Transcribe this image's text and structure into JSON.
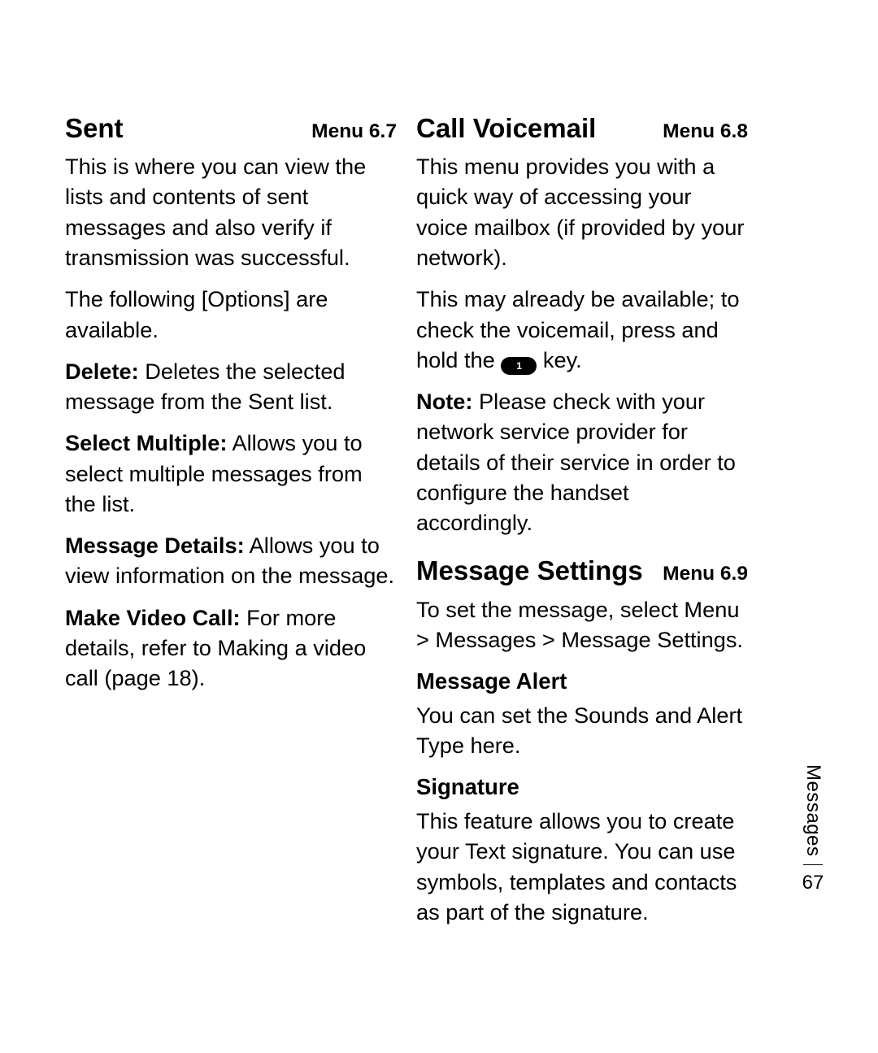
{
  "left": {
    "heading": "Sent",
    "menu": "Menu 6.7",
    "intro": "This is where you can view the lists and contents of sent messages and also verify if transmission was successful.",
    "options_intro": "The following [Options] are available.",
    "items": [
      {
        "term": "Delete:",
        "desc": " Deletes the selected message from the Sent list."
      },
      {
        "term": "Select Multiple:",
        "desc": " Allows you to select multiple messages from the list."
      },
      {
        "term": "Message Details:",
        "desc": " Allows you to view information on the message."
      },
      {
        "term": "Make Video Call:",
        "desc": " For more details, refer to Making a video call (page 18)."
      }
    ]
  },
  "right": {
    "voicemail": {
      "heading": "Call Voicemail",
      "menu": "Menu 6.8",
      "p1": "This menu provides you with a quick way of accessing your voice mailbox (if provided by your network).",
      "p2_pre": "This may already be available; to check the voicemail, press and hold the ",
      "key_label": "1",
      "p2_post": " key.",
      "note_term": "Note:",
      "note_body": " Please check with your network service provider for details of their service in order to configure the handset accordingly."
    },
    "settings": {
      "heading": "Message Settings",
      "menu": "Menu 6.9",
      "p1": "To set the message, select Menu > Messages > Message Settings.",
      "alert_head": "Message Alert",
      "alert_body": "You can set the Sounds and Alert Type here.",
      "sig_head": "Signature",
      "sig_body": "This feature allows you to create your Text signature. You can use symbols, templates and contacts as part of the signature."
    }
  },
  "side": {
    "section": "Messages",
    "page": "67"
  }
}
